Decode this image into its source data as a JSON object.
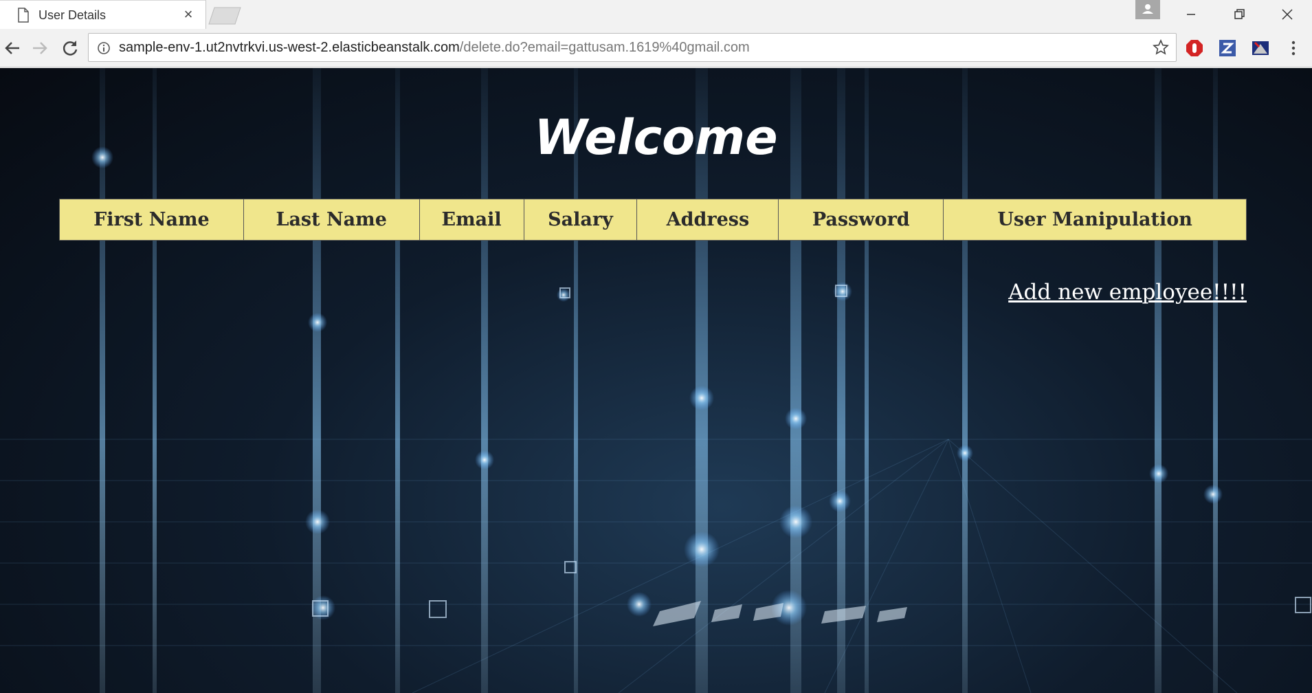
{
  "browser": {
    "tab_title": "User Details",
    "tab_close": "×",
    "url_host": "sample-env-1.ut2nvtrkvi.us-west-2.elasticbeanstalk.com",
    "url_path": "/delete.do?email=gattusam.1619%40gmail.com",
    "icons": [
      "document-icon",
      "back-icon",
      "forward-icon",
      "reload-icon",
      "info-icon",
      "star-icon",
      "extension-icon",
      "menu-icon"
    ]
  },
  "page": {
    "heading": "Welcome",
    "table": {
      "columns": [
        "First Name",
        "Last Name",
        "Email",
        "Salary",
        "Address",
        "Password",
        "User Manipulation"
      ],
      "rows": []
    },
    "add_link": "Add new employee!!!!"
  },
  "colors": {
    "header_bg": "#f0e68c",
    "background": "#0a1420",
    "link": "#ffffff"
  }
}
